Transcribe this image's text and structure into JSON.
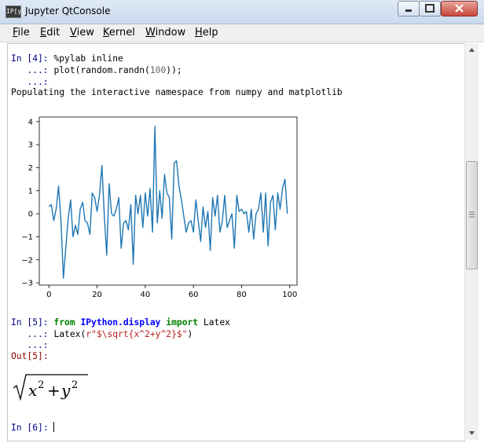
{
  "window": {
    "title": "Jupyter QtConsole",
    "icon": "IP[y]"
  },
  "menu": [
    "File",
    "Edit",
    "View",
    "Kernel",
    "Window",
    "Help"
  ],
  "cells": {
    "in4": {
      "prompt": "In [4]:",
      "line1": "%pylab inline",
      "cont": "...:",
      "line2_a": "plot(random.randn(",
      "line2_num": "100",
      "line2_b": "));",
      "output": "Populating the interactive namespace from numpy and matplotlib"
    },
    "in5": {
      "prompt": "In [5]:",
      "from_kw": "from",
      "module": "IPython.display",
      "import_kw": "import",
      "name": "Latex",
      "cont": "...:",
      "call_a": "Latex(",
      "call_str": "r\"$\\sqrt{x^2+y^2}$\"",
      "call_b": ")",
      "out_prompt": "Out[5]:"
    },
    "in6": {
      "prompt": "In [6]:"
    }
  },
  "chart_data": {
    "type": "line",
    "title": "",
    "xlabel": "",
    "ylabel": "",
    "xlim": [
      -4,
      103
    ],
    "ylim": [
      -3.1,
      4.2
    ],
    "x_ticks": [
      0,
      20,
      40,
      60,
      80,
      100
    ],
    "y_ticks": [
      -3,
      -2,
      -1,
      0,
      1,
      2,
      3,
      4
    ],
    "color": "#1f77b4",
    "grid": false,
    "series": [
      {
        "values": [
          0.3,
          0.4,
          -0.3,
          0.2,
          1.2,
          -0.3,
          -2.8,
          -1.5,
          -0.2,
          0.6,
          -1.0,
          -0.5,
          -0.9,
          0.2,
          0.5,
          -0.3,
          -0.4,
          -0.9,
          0.9,
          0.7,
          0.1,
          0.8,
          2.1,
          -0.1,
          -1.8,
          1.3,
          0.0,
          -0.1,
          0.2,
          0.7,
          -1.5,
          -0.4,
          -0.3,
          -0.7,
          0.4,
          -2.2,
          0.8,
          0.0,
          0.8,
          -0.6,
          0.9,
          -0.1,
          1.1,
          -0.8,
          3.8,
          -0.4,
          1.0,
          -0.2,
          1.7,
          0.9,
          0.7,
          -1.1,
          2.2,
          2.3,
          1.2,
          0.6,
          -0.1,
          -0.8,
          -0.4,
          -0.3,
          -0.8,
          0.6,
          -0.3,
          -1.2,
          0.3,
          -0.6,
          0.1,
          -1.6,
          0.7,
          -0.1,
          0.8,
          -0.8,
          -0.3,
          0.8,
          -0.6,
          -0.3,
          0.0,
          -1.5,
          0.8,
          0.1,
          0.2,
          0.0,
          0.1,
          -0.8,
          0.2,
          -1.1,
          0.0,
          0.2,
          0.9,
          -0.8,
          0.9,
          -1.4,
          0.5,
          0.8,
          -0.7,
          0.9,
          0.2,
          1.1,
          1.5,
          0.0
        ]
      }
    ]
  }
}
